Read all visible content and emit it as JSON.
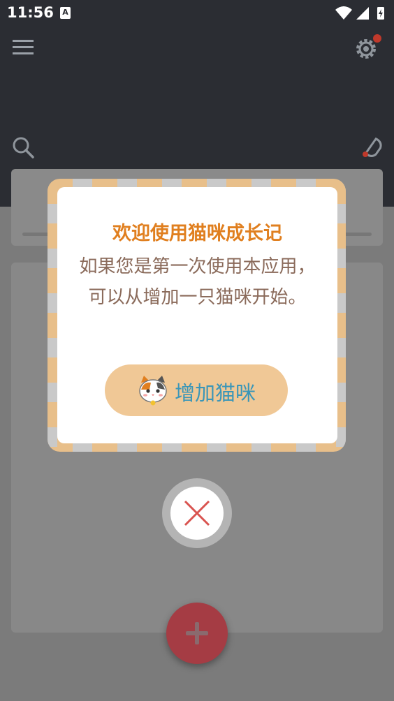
{
  "status_bar": {
    "time": "11:56",
    "notification_badge": "A"
  },
  "header": {
    "menu_icon": "hamburger-menu-icon",
    "settings_icon": "gear-icon",
    "search_icon": "search-icon",
    "reminder_icon": "bell-icon"
  },
  "dialog": {
    "title": "欢迎使用猫咪成长记",
    "message": "如果您是第一次使用本应用，可以从增加一只猫咪开始。",
    "button_label": "增加猫咪",
    "button_icon": "cat-face-icon",
    "close_icon": "close-icon"
  },
  "fab": {
    "icon": "plus-icon"
  },
  "colors": {
    "header_bg": "#2b2d33",
    "title": "#e07f1f",
    "message": "#8a6a5a",
    "button_bg": "#f0c896",
    "button_text": "#3a96b8",
    "fab": "#a53c44",
    "close_x": "#d9534f"
  }
}
